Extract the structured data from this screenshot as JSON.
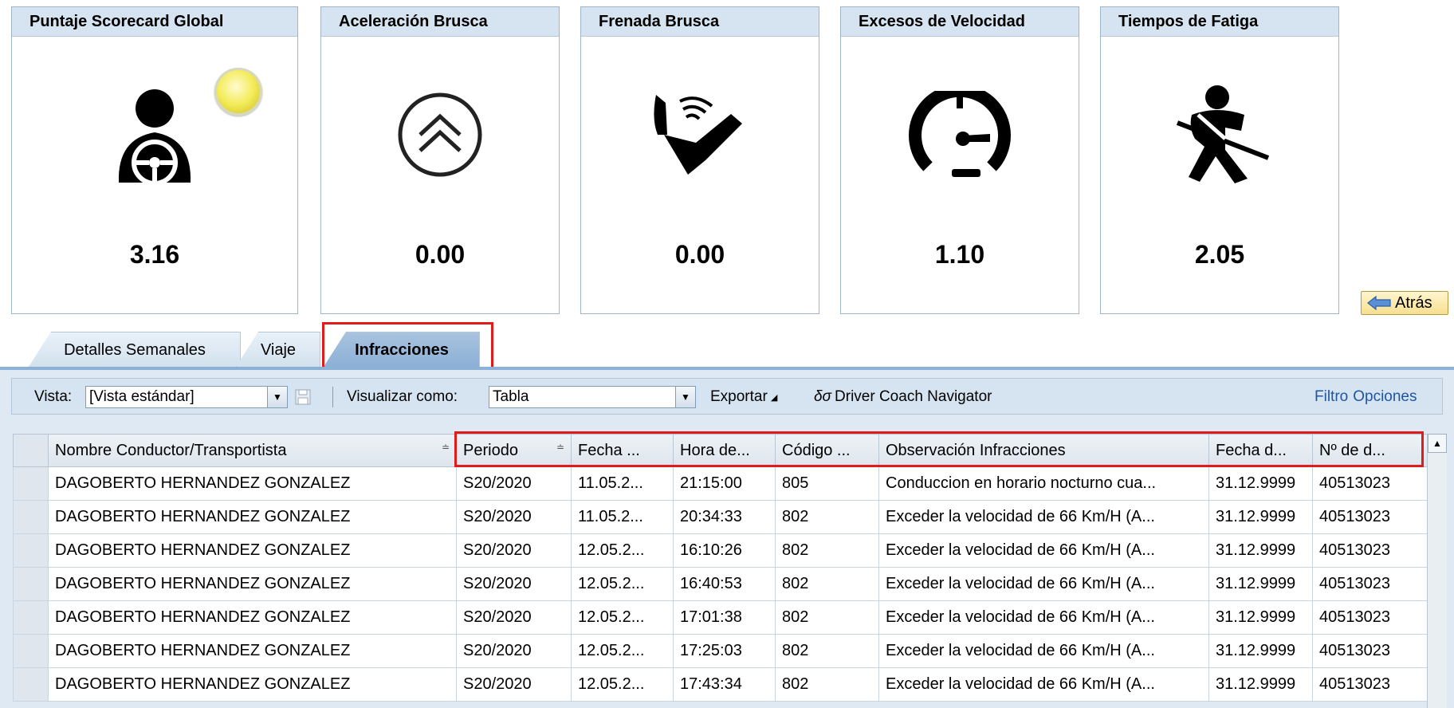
{
  "kpis": [
    {
      "title": "Puntaje Scorecard Global",
      "value": "3.16",
      "icon": "driver-steering-wheel-icon",
      "status": "yellow"
    },
    {
      "title": "Aceleración Brusca",
      "value": "0.00",
      "icon": "double-chevron-up-icon"
    },
    {
      "title": "Frenada Brusca",
      "value": "0.00",
      "icon": "brake-pedal-icon"
    },
    {
      "title": "Excesos de Velocidad",
      "value": "1.10",
      "icon": "speedometer-icon"
    },
    {
      "title": "Tiempos de Fatiga",
      "value": "2.05",
      "icon": "seatbelt-driver-icon"
    }
  ],
  "back_button": {
    "label": "Atrás"
  },
  "tabs": [
    {
      "label": "Detalles Semanales",
      "active": false
    },
    {
      "label": "Viaje",
      "active": false
    },
    {
      "label": "Infracciones",
      "active": true
    }
  ],
  "toolbar": {
    "view_label": "Vista:",
    "view_value": "[Vista estándar]",
    "display_as_label": "Visualizar como:",
    "display_as_value": "Tabla",
    "export_label": "Exportar",
    "navigator_label": "Driver Coach Navigator",
    "filter_label": "Filtro",
    "options_label": "Opciones"
  },
  "table": {
    "columns": [
      "Nombre Conductor/Transportista",
      "Periodo",
      "Fecha ...",
      "Hora de...",
      "Código ...",
      "Observación Infracciones",
      "Fecha d...",
      "Nº de d..."
    ],
    "rows": [
      [
        "DAGOBERTO HERNANDEZ GONZALEZ",
        "S20/2020",
        "11.05.2...",
        "21:15:00",
        "805",
        "Conduccion en horario nocturno cua...",
        "31.12.9999",
        "40513023"
      ],
      [
        "DAGOBERTO HERNANDEZ GONZALEZ",
        "S20/2020",
        "11.05.2...",
        "20:34:33",
        "802",
        "Exceder la velocidad de 66 Km/H (A...",
        "31.12.9999",
        "40513023"
      ],
      [
        "DAGOBERTO HERNANDEZ GONZALEZ",
        "S20/2020",
        "12.05.2...",
        "16:10:26",
        "802",
        "Exceder la velocidad de 66 Km/H (A...",
        "31.12.9999",
        "40513023"
      ],
      [
        "DAGOBERTO HERNANDEZ GONZALEZ",
        "S20/2020",
        "12.05.2...",
        "16:40:53",
        "802",
        "Exceder la velocidad de 66 Km/H (A...",
        "31.12.9999",
        "40513023"
      ],
      [
        "DAGOBERTO HERNANDEZ GONZALEZ",
        "S20/2020",
        "12.05.2...",
        "17:01:38",
        "802",
        "Exceder la velocidad de 66 Km/H (A...",
        "31.12.9999",
        "40513023"
      ],
      [
        "DAGOBERTO HERNANDEZ GONZALEZ",
        "S20/2020",
        "12.05.2...",
        "17:25:03",
        "802",
        "Exceder la velocidad de 66 Km/H (A...",
        "31.12.9999",
        "40513023"
      ],
      [
        "DAGOBERTO HERNANDEZ GONZALEZ",
        "S20/2020",
        "12.05.2...",
        "17:43:34",
        "802",
        "Exceder la velocidad de 66 Km/H (A...",
        "31.12.9999",
        "40513023"
      ]
    ]
  },
  "colors": {
    "highlight": "#e01b1b",
    "tile_header": "#d6e4f1",
    "active_tab": "#8cb0d6",
    "link": "#1f56a0"
  }
}
